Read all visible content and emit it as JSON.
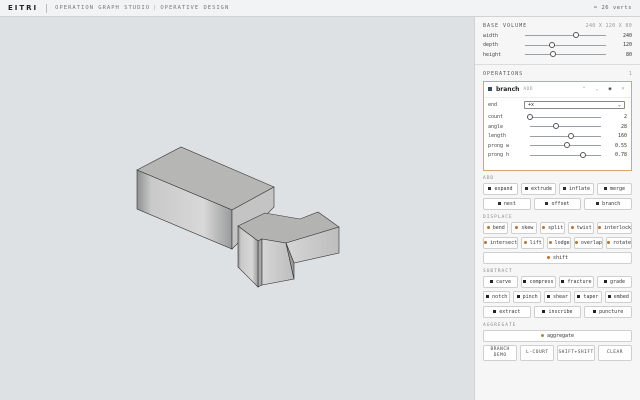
{
  "header": {
    "logo": "EITRI",
    "crumb_1": "OPERATION GRAPH STUDIO",
    "crumb_2": "OPERATIVE DESIGN",
    "vert_count": "≈ 26 verts"
  },
  "base_volume": {
    "title": "BASE VOLUME",
    "dims": "240 X 120 X 80",
    "sliders": [
      {
        "label": "width",
        "value": "240",
        "fraction": 0.63
      },
      {
        "label": "depth",
        "value": "120",
        "fraction": 0.33
      },
      {
        "label": "height",
        "value": "80",
        "fraction": 0.34
      }
    ]
  },
  "operations": {
    "title": "OPERATIONS",
    "count": "1",
    "card": {
      "name": "branch",
      "tag": "ADD",
      "controls": [
        "⌃",
        "⌄",
        "◉",
        "×"
      ],
      "end_label": "end",
      "end_value": "+x",
      "params": [
        {
          "label": "count",
          "value": "2",
          "fraction": 0.0
        },
        {
          "label": "angle",
          "value": "28",
          "fraction": 0.37
        },
        {
          "label": "length",
          "value": "160",
          "fraction": 0.58
        },
        {
          "label": "prong w",
          "value": "0.55",
          "fraction": 0.52
        },
        {
          "label": "prong h",
          "value": "0.78",
          "fraction": 0.74
        }
      ]
    }
  },
  "groups": {
    "add": {
      "title": "ADD",
      "rows": [
        [
          "expand",
          "extrude",
          "inflate",
          "merge"
        ],
        [
          "nest",
          "offset",
          "branch"
        ]
      ]
    },
    "displace": {
      "title": "DISPLACE",
      "rows": [
        [
          "bend",
          "skew",
          "split",
          "twist",
          "interlock"
        ],
        [
          "intersect",
          "lift",
          "lodge",
          "overlap",
          "rotate"
        ]
      ],
      "wide": "shift"
    },
    "subtract": {
      "title": "SUBTRACT",
      "rows": [
        [
          "carve",
          "compress",
          "fracture",
          "grade"
        ],
        [
          "notch",
          "pinch",
          "shear",
          "taper",
          "embed"
        ],
        [
          "extract",
          "inscribe",
          "puncture"
        ]
      ]
    },
    "aggregate": {
      "title": "AGGREGATE",
      "wide": "aggregate"
    }
  },
  "bottom_buttons": [
    "BRANCH\nDEMO",
    "L-COURT",
    "SHIFT+SHIFT",
    "CLEAR"
  ],
  "colors": {
    "accent": "#d4a86a",
    "add_dot": "#2a2e33",
    "displace_dot": "#c2702c",
    "aggregate_dot": "#b08a3a"
  }
}
